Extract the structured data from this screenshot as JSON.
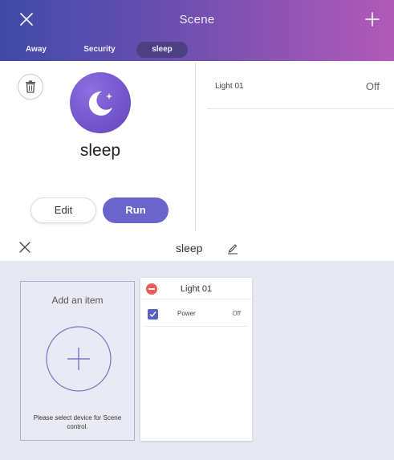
{
  "scene_screen": {
    "title": "Scene",
    "tabs": [
      {
        "label": "Away"
      },
      {
        "label": "Security"
      },
      {
        "label": "sleep",
        "selected": true
      }
    ],
    "scene": {
      "name": "sleep",
      "icon": "moon-icon",
      "edit_label": "Edit",
      "run_label": "Run"
    },
    "devices": [
      {
        "name": "Light 01",
        "state": "Off"
      }
    ]
  },
  "edit_screen": {
    "title": "sleep",
    "add_item": {
      "title": "Add an item",
      "hint": "Please select device for Scene control."
    },
    "device_card": {
      "title": "Light 01",
      "options": [
        {
          "label": "Power",
          "value": "Off",
          "checked": true
        }
      ]
    }
  },
  "colors": {
    "header_gradient_start": "#3f4aa6",
    "header_gradient_end": "#b25ab7",
    "accent": "#6a64cb",
    "remove_red": "#ee5a58",
    "edit_background": "#e8e8f3"
  }
}
